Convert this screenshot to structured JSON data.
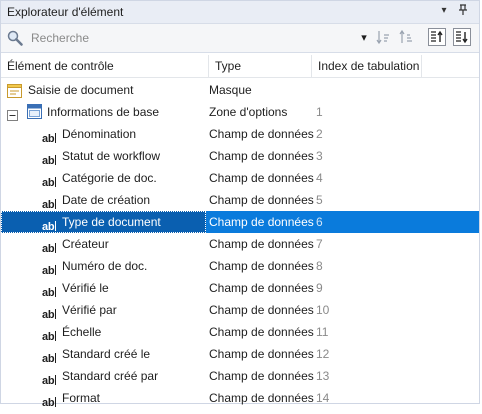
{
  "panel": {
    "title": "Explorateur d'élément",
    "pin_glyph": "▾",
    "pin_icon_glyph": "⊥"
  },
  "toolbar": {
    "search_placeholder": "Recherche",
    "dropdown_glyph": "▾"
  },
  "columns": {
    "element": "Élément de contrôle",
    "type": "Type",
    "tab_index": "Index de tabulation"
  },
  "rows": [
    {
      "name": "Saisie de document",
      "type": "Masque",
      "index": "",
      "icon": "form-icon",
      "level": 0
    },
    {
      "name": "Informations de base",
      "type": "Zone d'options",
      "index": "1",
      "icon": "options-zone-icon",
      "level": 0,
      "expander": "⊟"
    },
    {
      "name": "Dénomination",
      "type": "Champ de données",
      "index": "2",
      "icon": "text-field-icon",
      "level": 2
    },
    {
      "name": "Statut de workflow",
      "type": "Champ de données",
      "index": "3",
      "icon": "text-field-icon",
      "level": 2
    },
    {
      "name": "Catégorie de doc.",
      "type": "Champ de données",
      "index": "4",
      "icon": "text-field-icon",
      "level": 2
    },
    {
      "name": "Date de création",
      "type": "Champ de données",
      "index": "5",
      "icon": "text-field-icon",
      "level": 2
    },
    {
      "name": "Type de document",
      "type": "Champ de données",
      "index": "6",
      "icon": "text-field-icon",
      "level": 2,
      "selected": true
    },
    {
      "name": "Créateur",
      "type": "Champ de données",
      "index": "7",
      "icon": "text-field-icon",
      "level": 2
    },
    {
      "name": "Numéro de doc.",
      "type": "Champ de données",
      "index": "8",
      "icon": "text-field-icon",
      "level": 2
    },
    {
      "name": "Vérifié le",
      "type": "Champ de données",
      "index": "9",
      "icon": "text-field-icon",
      "level": 2
    },
    {
      "name": "Vérifié par",
      "type": "Champ de données",
      "index": "10",
      "icon": "text-field-icon",
      "level": 2
    },
    {
      "name": "Échelle",
      "type": "Champ de données",
      "index": "11",
      "icon": "text-field-icon",
      "level": 2
    },
    {
      "name": "Standard créé le",
      "type": "Champ de données",
      "index": "12",
      "icon": "text-field-icon",
      "level": 2
    },
    {
      "name": "Standard créé par",
      "type": "Champ de données",
      "index": "13",
      "icon": "text-field-icon",
      "level": 2
    },
    {
      "name": "Format",
      "type": "Champ de données",
      "index": "14",
      "icon": "text-field-icon",
      "level": 2
    }
  ],
  "field_icon_text": "ab",
  "colors": {
    "selection": "#0a7bdc",
    "selection_cell": "#0a5fb0",
    "title_bg": "#e9edf5"
  }
}
